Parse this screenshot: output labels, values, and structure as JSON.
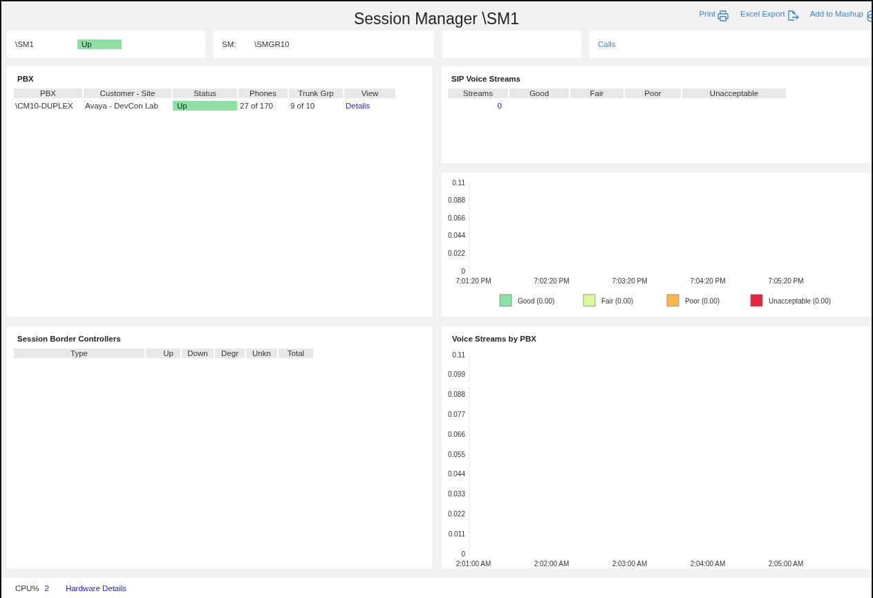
{
  "header": {
    "title": "Session Manager \\SM1",
    "actions": [
      {
        "label": "Print",
        "kind": "print"
      },
      {
        "label": "Excel Export",
        "kind": "export"
      },
      {
        "label": "Add to Mashup",
        "kind": "mashup"
      }
    ]
  },
  "summary": {
    "name": "\\SM1",
    "status": "Up",
    "sm_label": "SM:",
    "sm_value": "\\SMGR10",
    "calls_link": "Calls"
  },
  "pbx": {
    "title": "PBX",
    "columns": [
      "PBX",
      "Customer - Site",
      "Status",
      "Phones",
      "Trunk Grp",
      "View"
    ],
    "rows": [
      {
        "pbx": "\\CM10-DUPLEX",
        "site": "Avaya - DevCon Lab",
        "status": "Up",
        "phones": "27 of 170",
        "trunk": "9 of 10",
        "view": "Details"
      }
    ]
  },
  "sip": {
    "title": "SIP Voice Streams",
    "columns": [
      "Streams",
      "Good",
      "Fair",
      "Poor",
      "Unacceptable"
    ],
    "streams": "0",
    "chart_data": {
      "type": "line",
      "categories": [
        "7:01:20 PM",
        "7:02:20 PM",
        "7:03:20 PM",
        "7:04:20 PM",
        "7:05:20 PM"
      ],
      "ylim": [
        0,
        0.11
      ],
      "yticks": [
        0,
        0.022,
        0.044,
        0.066,
        0.088,
        0.11
      ],
      "series": [
        {
          "name": "Good (0.00)",
          "color": "#8ce0a0",
          "values": [
            null,
            null,
            null,
            null,
            null
          ]
        },
        {
          "name": "Fair (0.00)",
          "color": "#d9f99d",
          "values": [
            null,
            null,
            null,
            null,
            null
          ]
        },
        {
          "name": "Poor (0.00)",
          "color": "#ffb74d",
          "values": [
            null,
            null,
            null,
            null,
            null
          ]
        },
        {
          "name": "Unacceptable (0.00)",
          "color": "#e8253a",
          "values": [
            null,
            null,
            null,
            null,
            null
          ]
        }
      ]
    }
  },
  "sbc": {
    "title": "Session Border Controllers",
    "columns": [
      "Type",
      "Up",
      "Down",
      "Degr",
      "Unkn",
      "Total"
    ]
  },
  "by_pbx": {
    "title": "Voice Streams by PBX",
    "chart_data": {
      "type": "line",
      "categories": [
        "2:01:00 AM",
        "2:02:00 AM",
        "2:03:00 AM",
        "2:04:00 AM",
        "2:05:00 AM"
      ],
      "ylim": [
        0,
        0.11
      ],
      "yticks": [
        0,
        0.011,
        0.022,
        0.033,
        0.044,
        0.055,
        0.066,
        0.077,
        0.088,
        0.099,
        0.11
      ]
    }
  },
  "footer": {
    "cpu_label": "CPU%",
    "cpu_value": "2",
    "hardware_link": "Hardware Details"
  }
}
